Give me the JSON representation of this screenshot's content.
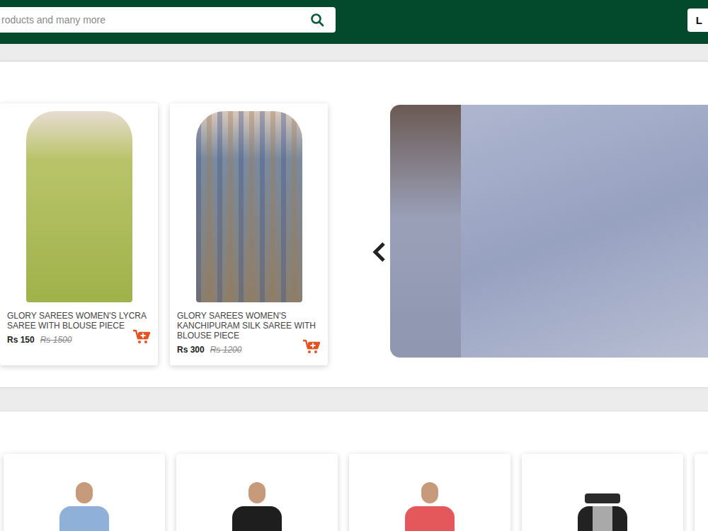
{
  "header": {
    "search": {
      "placeholder": "roducts and many more"
    },
    "login_button": {
      "label": "L"
    }
  },
  "featured": {
    "products": [
      {
        "title": "GLORY SAREES WOMEN'S LYCRA SAREE WITH BLOUSE PIECE",
        "price": "Rs 150",
        "old_price": "Rs 1500"
      },
      {
        "title": "GLORY SAREES WOMEN'S KANCHIPURAM SILK SAREE WITH BLOUSE PIECE",
        "price": "Rs 300",
        "old_price": "Rs 1200"
      }
    ],
    "banner": {}
  },
  "men_products": [
    {},
    {},
    {},
    {},
    {}
  ]
}
